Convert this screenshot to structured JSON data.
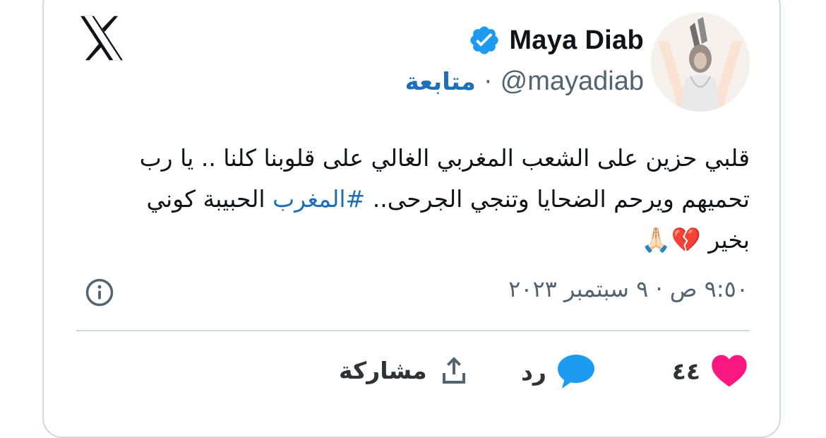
{
  "author": {
    "display_name": "Maya Diab",
    "handle": "@mayadiab",
    "verified": true,
    "follow_label": "متابعة",
    "separator": "·"
  },
  "tweet": {
    "text_part1": "قلبي حزين على الشعب المغربي الغالي على قلوبنا كلنا .. يا رب تحميهم ويرحم الضحايا وتنجي الجرحى.. ",
    "hashtag": "#المغرب",
    "text_part2": " الحبيبة كوني بخير ",
    "emojis": "💔🙏🏻",
    "timestamp": "٩:٥٠ ص · ٩ سبتمبر ٢٠٢٣"
  },
  "actions": {
    "likes_count": "٤٤",
    "reply_label": "رد",
    "share_label": "مشاركة"
  },
  "icons": {
    "logo": "x-logo-icon",
    "verified": "verified-badge-icon",
    "info": "info-icon",
    "like": "heart-icon",
    "reply": "speech-bubble-icon",
    "share": "share-icon"
  },
  "colors": {
    "link": "#1d6fb8",
    "verified": "#1d9bf0",
    "heart": "#f91880",
    "muted": "#536471",
    "border": "#cfd9de"
  }
}
